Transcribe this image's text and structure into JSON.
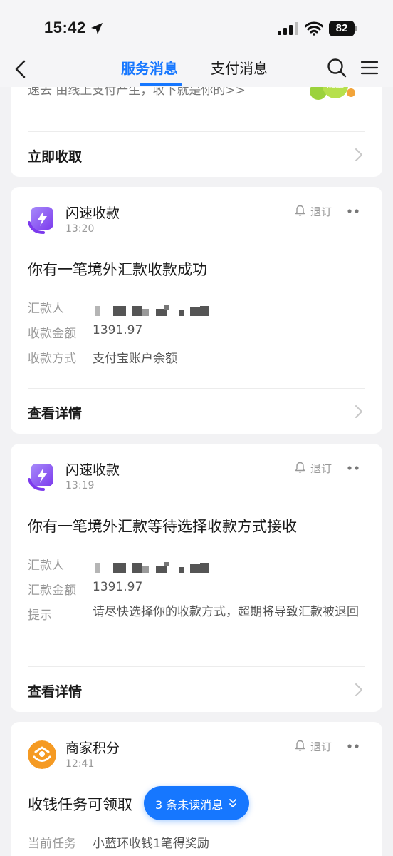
{
  "status_bar": {
    "time": "15:42",
    "battery": "82"
  },
  "nav": {
    "tabs": [
      {
        "label": "服务消息",
        "active": true
      },
      {
        "label": "支付消息",
        "active": false
      }
    ]
  },
  "top_card": {
    "partial_text": "速去 由线上支付产生，收下就是你的>>",
    "action": "立即收取"
  },
  "messages": [
    {
      "app": "闪速收款",
      "time": "13:20",
      "unsubscribe": "退订",
      "title": "你有一笔境外汇款收款成功",
      "fields": [
        {
          "label": "汇款人",
          "value": ""
        },
        {
          "label": "收款金额",
          "value": "1391.97"
        },
        {
          "label": "收款方式",
          "value": "支付宝账户余额"
        }
      ],
      "action": "查看详情"
    },
    {
      "app": "闪速收款",
      "time": "13:19",
      "unsubscribe": "退订",
      "title": "你有一笔境外汇款等待选择收款方式接收",
      "fields": [
        {
          "label": "汇款人",
          "value": ""
        },
        {
          "label": "汇款金额",
          "value": "1391.97"
        },
        {
          "label": "提示",
          "value": "请尽快选择你的收款方式，超期将导致汇款被退回"
        }
      ],
      "action": "查看详情"
    },
    {
      "app": "商家积分",
      "time": "12:41",
      "unsubscribe": "退订",
      "title": "收钱任务可领取",
      "fields": [
        {
          "label": "当前任务",
          "value": "小蓝环收钱1笔得奖励"
        }
      ]
    }
  ],
  "unread_pill": {
    "label": "3 条未读消息"
  },
  "colors": {
    "accent": "#1677ff",
    "background": "#f2f2f4",
    "lightning_icon": "#8b5cf6",
    "points_icon": "#f59a23"
  },
  "icons": [
    "location-arrow-icon",
    "signal-icon",
    "wifi-icon",
    "battery-icon",
    "back-icon",
    "search-icon",
    "menu-icon",
    "chevron-right-icon",
    "lightning-app-icon",
    "bell-icon",
    "more-icon",
    "points-app-icon",
    "chevron-down-icon"
  ]
}
